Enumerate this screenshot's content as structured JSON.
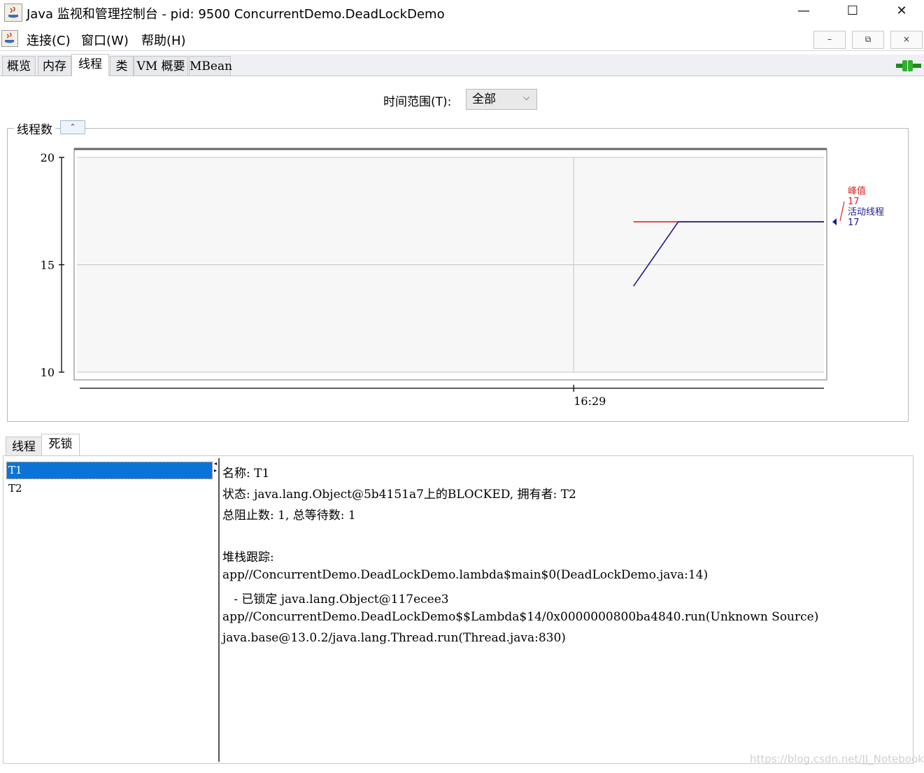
{
  "window": {
    "title": "Java 监视和管理控制台 - pid: 9500 ConcurrentDemo.DeadLockDemo",
    "minimize_glyph": "—",
    "maximize_glyph": "☐",
    "close_glyph": "✕"
  },
  "menu": {
    "items": [
      "连接(C)",
      "窗口(W)",
      "帮助(H)"
    ],
    "inner_buttons": [
      "–",
      "⧉",
      "×"
    ]
  },
  "tabs": [
    {
      "label": "概览",
      "active": false
    },
    {
      "label": "内存",
      "active": false
    },
    {
      "label": "线程",
      "active": true
    },
    {
      "label": "类",
      "active": false
    },
    {
      "label": "VM 概要",
      "active": false
    },
    {
      "label": "MBean",
      "active": false
    }
  ],
  "connection_icon": "plug-connected-icon",
  "time_range": {
    "label": "时间范围(T):",
    "selected": "全部"
  },
  "chart_panel": {
    "title": "线程数",
    "collapse_glyph": "⌃"
  },
  "chart_data": {
    "type": "line",
    "title": "线程数",
    "ylim": [
      10,
      20
    ],
    "y_ticks": [
      "10",
      "15",
      "20"
    ],
    "x_tick_labels": [
      "16:29"
    ],
    "grid": true,
    "legend_position": "right",
    "series": [
      {
        "name": "峰值",
        "color": "#e02020",
        "current": "17",
        "points": [
          [
            0.745,
            17
          ],
          [
            0.805,
            17
          ],
          [
            1.0,
            17
          ]
        ]
      },
      {
        "name": "活动线程",
        "color": "#1a1a8c",
        "current": "17",
        "points": [
          [
            0.745,
            14
          ],
          [
            0.805,
            17
          ],
          [
            1.0,
            17
          ]
        ]
      }
    ],
    "x_tick_position": 0.665
  },
  "bottom_tabs": [
    {
      "label": "线程",
      "active": false
    },
    {
      "label": "死锁",
      "active": true
    }
  ],
  "deadlock_threads": [
    {
      "name": "T1",
      "selected": true
    },
    {
      "name": "T2",
      "selected": false
    }
  ],
  "details": {
    "name_line": "名称: T1",
    "state_line": "状态: java.lang.Object@5b4151a7上的BLOCKED, 拥有者: T2",
    "counts_line": "总阻止数: 1, 总等待数: 1",
    "stack_header": "堆栈跟踪:",
    "stack": [
      "app//ConcurrentDemo.DeadLockDemo.lambda$main$0(DeadLockDemo.java:14)",
      "   - 已锁定 java.lang.Object@117ecee3",
      "app//ConcurrentDemo.DeadLockDemo$$Lambda$14/0x0000000800ba4840.run(Unknown Source)",
      "java.base@13.0.2/java.lang.Thread.run(Thread.java:830)"
    ]
  },
  "watermark": "https://blog.csdn.net/JJ_Notebook"
}
